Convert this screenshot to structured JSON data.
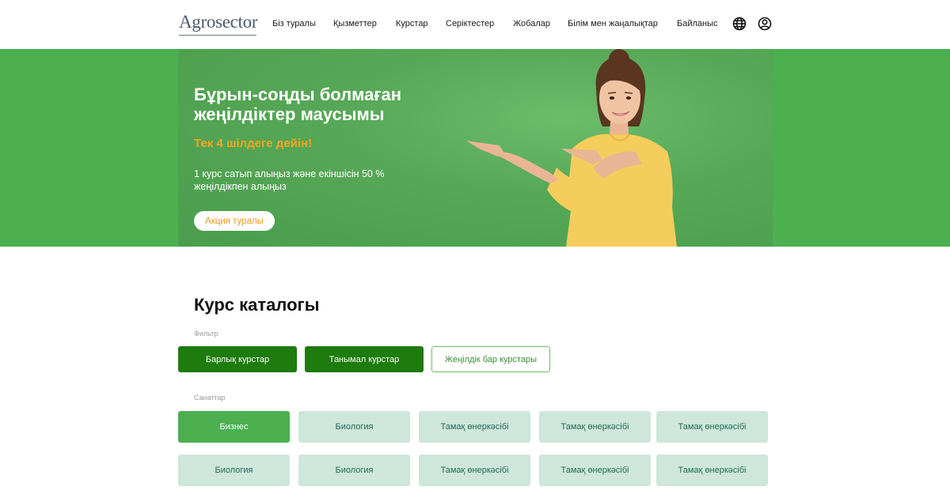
{
  "header": {
    "logo_text": "Agrosector",
    "nav": [
      "Біз туралы",
      "Қызметтер",
      "Курстар",
      "Серіктестер",
      "Жобалар",
      "Білім мен жаңалықтар",
      "Байланыс"
    ],
    "icons": [
      "globe-icon",
      "user-icon"
    ]
  },
  "hero": {
    "title": "Бұрын-соңды болмаған жеңілдіктер маусымы",
    "subtitle": "Тек 4 шілдеге дейін!",
    "text": "1 курс сатып алыңыз және екіншісін 50 % жеңілдікпен  алыңыз",
    "button": "Акция туралы"
  },
  "catalog": {
    "title": "Курс каталогы",
    "filter_label": "Фильтр",
    "filters": [
      "Барлық курстар",
      "Танымал курстар",
      "Жеңілдік бар курстары"
    ],
    "categories_label": "Санаттар",
    "categories": [
      "Бизнес",
      "Биология",
      "Тамақ өнеркәсібі",
      "Тамақ өнеркәсібі",
      "Тамақ өнеркәсібі",
      "Биология",
      "Биология",
      "Тамақ өнеркәсібі",
      "Тамақ өнеркәсібі",
      "Тамақ өнеркәсібі"
    ]
  },
  "colors": {
    "green": "#4caf50",
    "dark_green": "#1e7b0d",
    "orange": "#f5a623",
    "category_bg": "#cfe6da"
  }
}
